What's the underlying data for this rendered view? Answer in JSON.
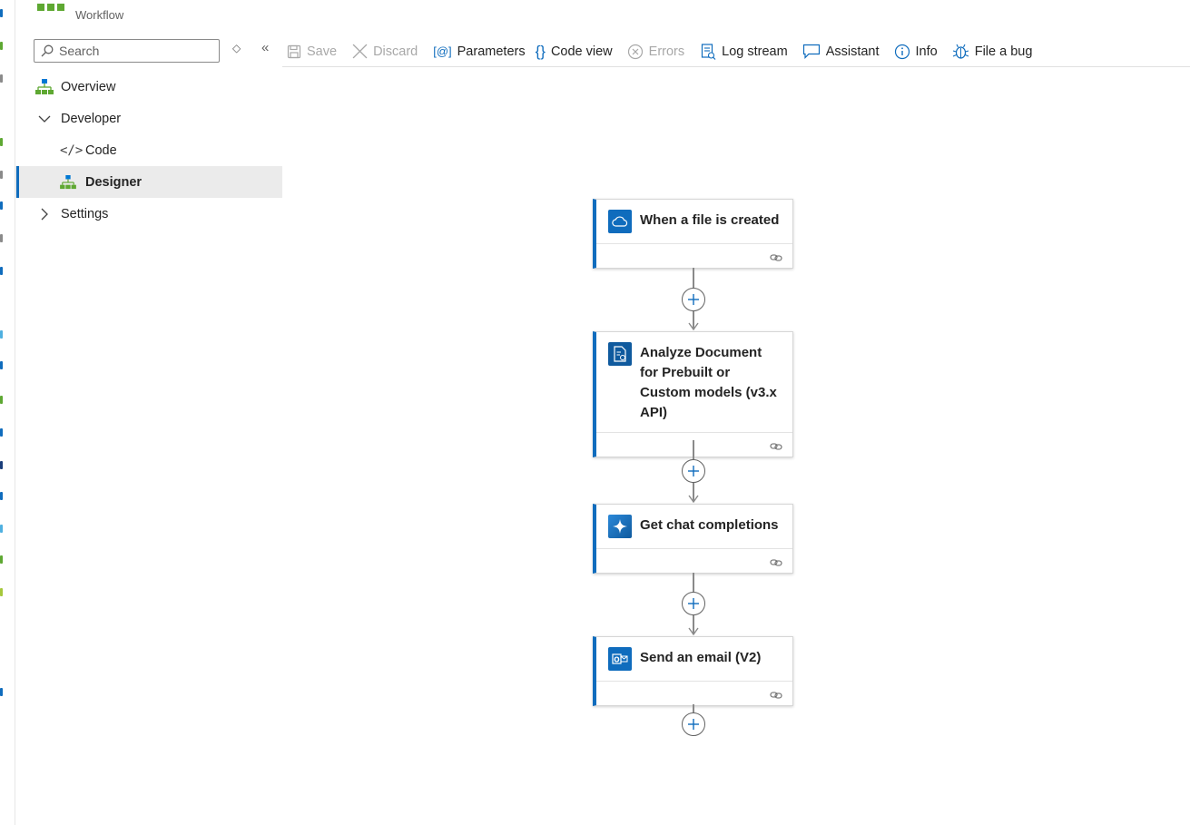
{
  "header": {
    "title": "Workflow",
    "subtitle": "Workflow"
  },
  "sidebar": {
    "search_placeholder": "Search",
    "items": [
      {
        "label": "Overview",
        "icon": "workflow-icon"
      },
      {
        "label": "Developer",
        "icon": "chevron-down-icon",
        "expanded": true
      },
      {
        "label": "Code",
        "icon": "code-icon"
      },
      {
        "label": "Designer",
        "icon": "workflow-icon",
        "selected": true
      },
      {
        "label": "Settings",
        "icon": "chevron-right-icon",
        "expanded": false
      }
    ]
  },
  "toolbar": {
    "save": "Save",
    "discard": "Discard",
    "parameters": "Parameters",
    "code_view": "Code view",
    "errors": "Errors",
    "log_stream": "Log stream",
    "assistant": "Assistant",
    "info": "Info",
    "file_bug": "File a bug"
  },
  "workflow": {
    "steps": [
      {
        "title": "When a file is created",
        "icon": "cloud-icon"
      },
      {
        "title": "Analyze Document for Prebuilt or Custom models (v3.x API)",
        "icon": "document-icon"
      },
      {
        "title": "Get chat completions",
        "icon": "sparkle-icon"
      },
      {
        "title": "Send an email (V2)",
        "icon": "outlook-icon"
      }
    ]
  },
  "colors": {
    "accent": "#0f6cbd",
    "icon_green": "#5ea832",
    "icon_blue": "#0078d4"
  }
}
